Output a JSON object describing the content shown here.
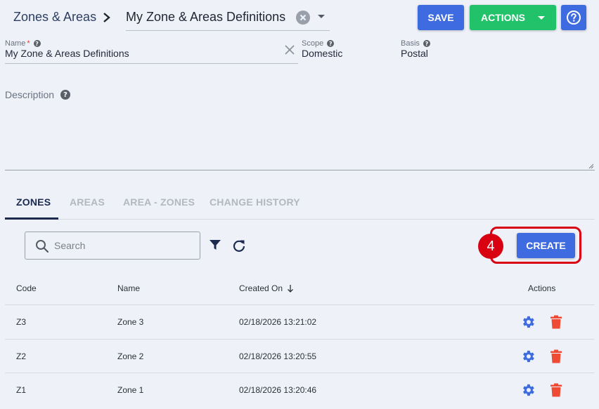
{
  "breadcrumb": {
    "root": "Zones & Areas",
    "selected": "My Zone & Areas Definitions"
  },
  "toolbar": {
    "save_label": "SAVE",
    "actions_label": "ACTIONS"
  },
  "form": {
    "name": {
      "label": "Name",
      "required_mark": "*",
      "value": "My Zone & Areas Definitions"
    },
    "scope": {
      "label": "Scope",
      "value": "Domestic"
    },
    "basis": {
      "label": "Basis",
      "value": "Postal"
    },
    "description": {
      "label": "Description",
      "value": ""
    }
  },
  "tabs": [
    {
      "label": "ZONES",
      "active": true
    },
    {
      "label": "AREAS",
      "active": false
    },
    {
      "label": "AREA - ZONES",
      "active": false
    },
    {
      "label": "CHANGE HISTORY",
      "active": false
    }
  ],
  "search": {
    "placeholder": "Search",
    "value": ""
  },
  "step_badge": "4",
  "create_label": "CREATE",
  "table": {
    "headers": {
      "code": "Code",
      "name": "Name",
      "created_on": "Created On",
      "actions": "Actions"
    },
    "rows": [
      {
        "code": "Z3",
        "name": "Zone 3",
        "created_on": "02/18/2026 13:21:02"
      },
      {
        "code": "Z2",
        "name": "Zone 2",
        "created_on": "02/18/2026 13:20:55"
      },
      {
        "code": "Z1",
        "name": "Zone 1",
        "created_on": "02/18/2026 13:20:46"
      }
    ]
  },
  "colors": {
    "primary": "#3f6be0",
    "success": "#22c26a",
    "danger": "#ef4a34",
    "highlight": "#d90012",
    "navy": "#1c2a4f"
  },
  "icons": [
    "chevron-right-icon",
    "clear-icon",
    "caret-down-icon",
    "help-icon",
    "info-icon",
    "search-icon",
    "filter-icon",
    "refresh-icon",
    "sort-down-icon",
    "gear-icon",
    "trash-icon"
  ]
}
